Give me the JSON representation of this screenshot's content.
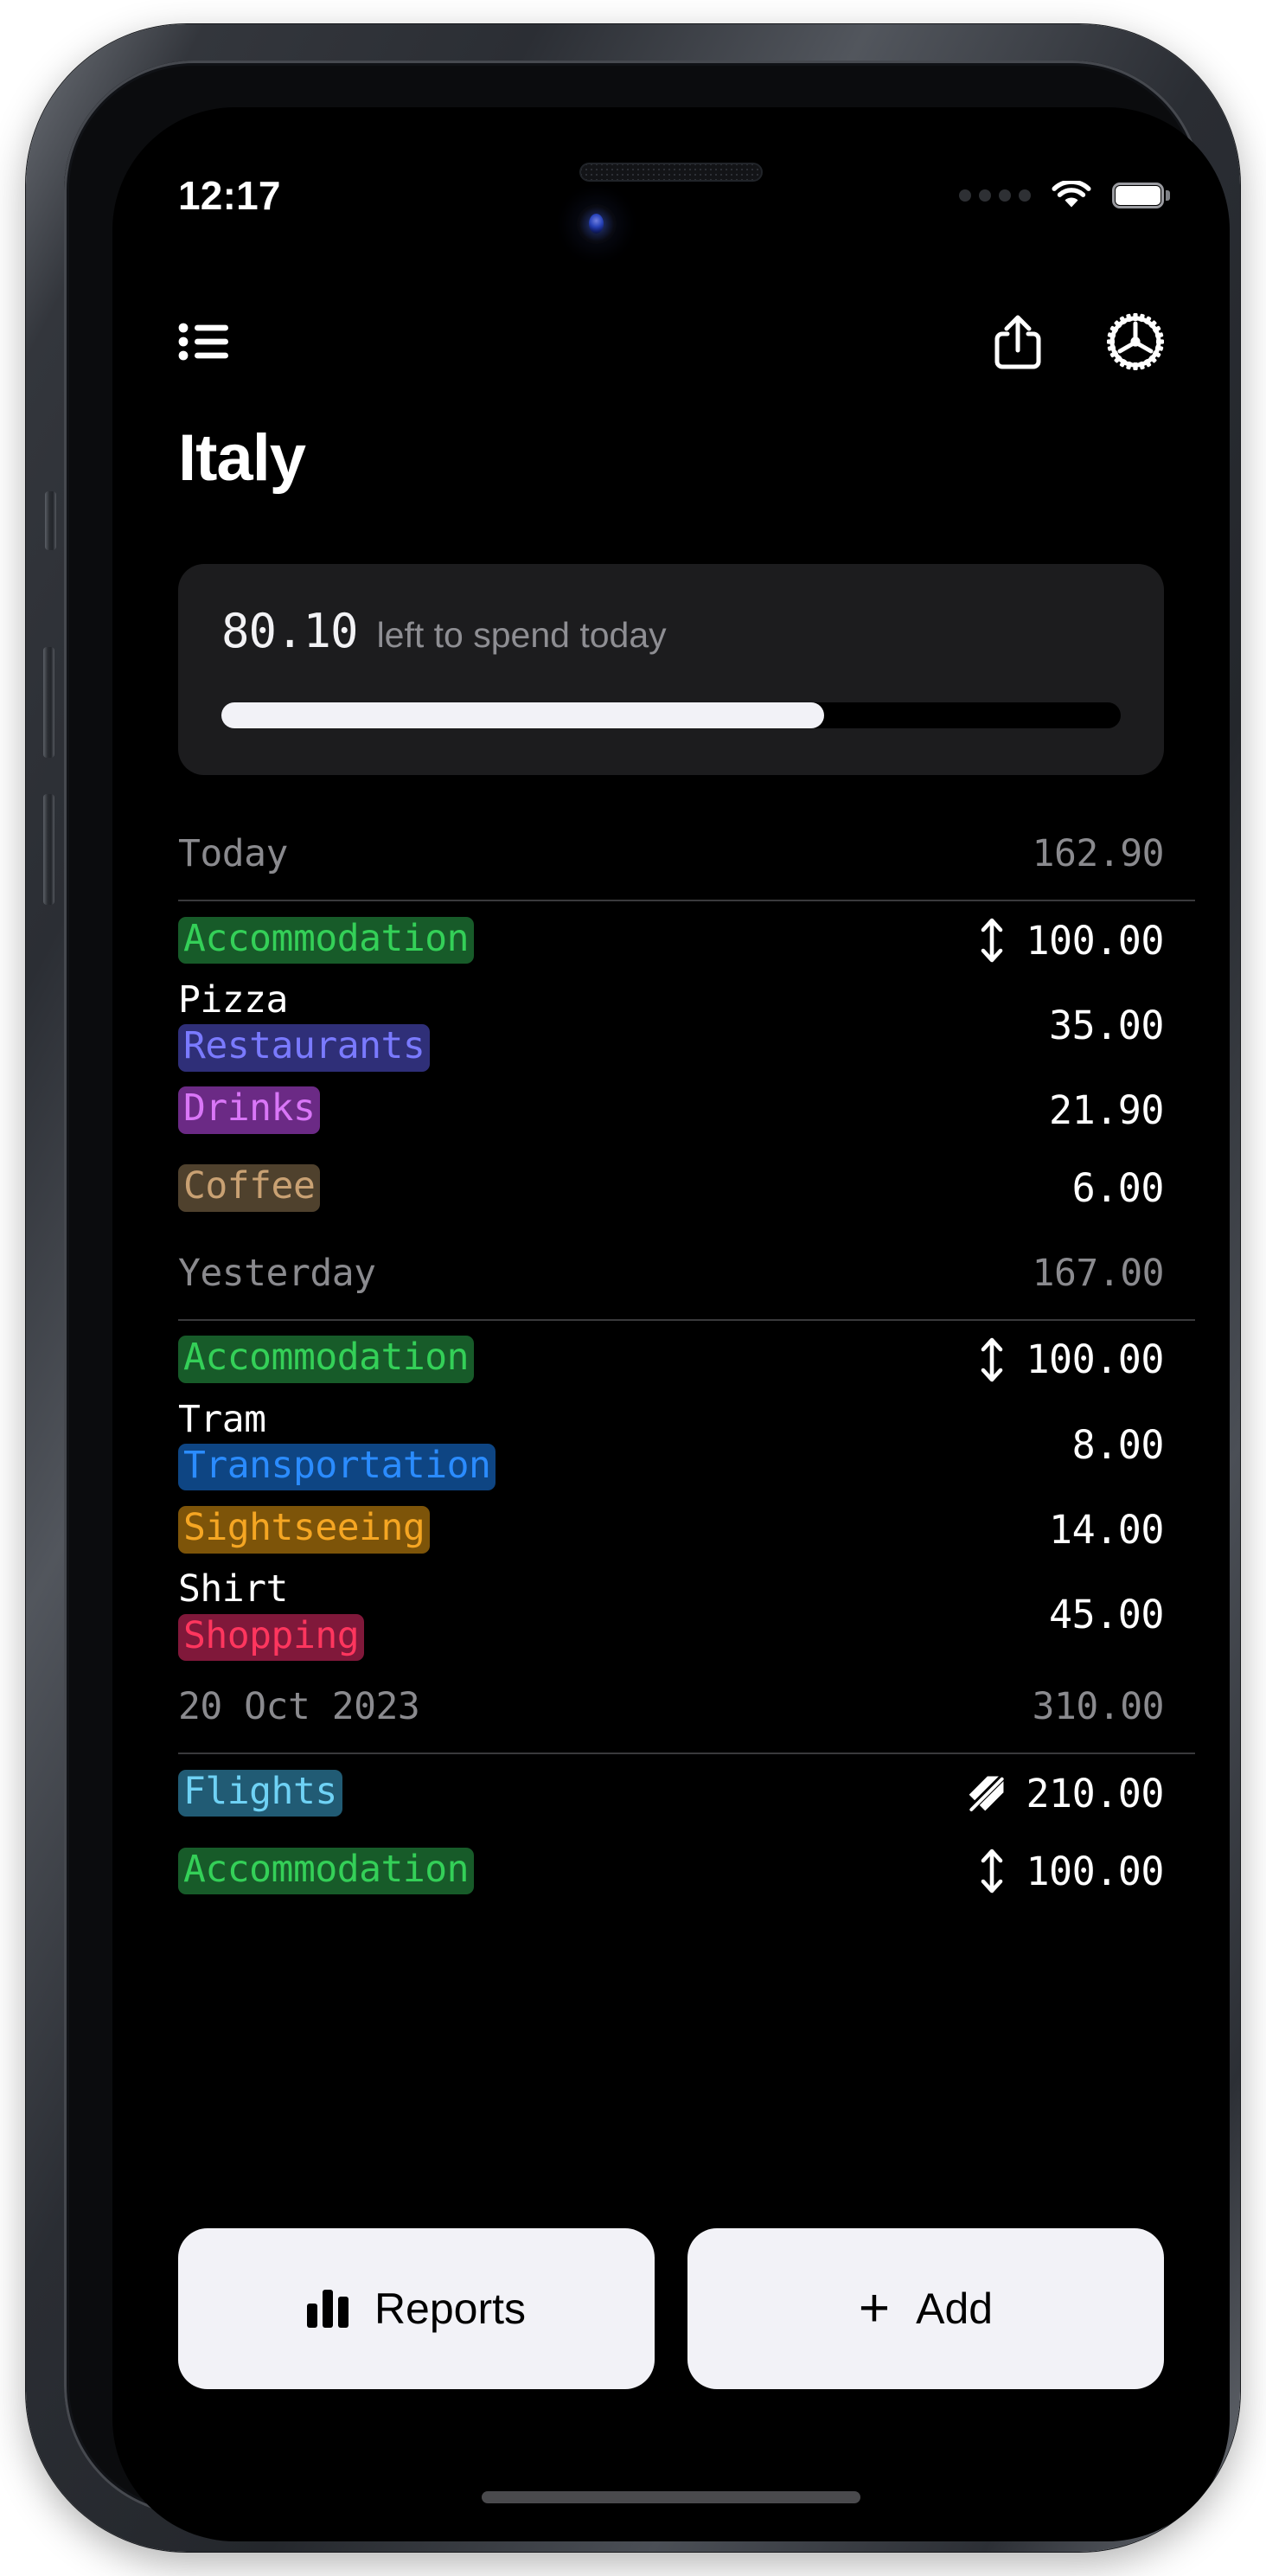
{
  "status_bar": {
    "time": "12:17",
    "signal_icon": "signal-dots-icon",
    "wifi_icon": "wifi-icon",
    "battery_icon": "battery-full-icon"
  },
  "header": {
    "menu_icon": "bulleted-list-icon",
    "share_icon": "share-icon",
    "settings_icon": "gear-icon"
  },
  "page_title": "Italy",
  "budget_card": {
    "amount": "80.10",
    "label": "left to spend today",
    "progress_percent": 67,
    "track_color": "#000000",
    "fill_color": "#f2f2f7",
    "card_color": "#1c1c1e"
  },
  "sections": [
    {
      "title": "Today",
      "total": "162.90",
      "rows": [
        {
          "note": "",
          "tag": "Accommodation",
          "tag_text_color": "#34d058",
          "tag_bg_color": "#175b29",
          "icon": "spread-arrows-icon",
          "amount": "100.00"
        },
        {
          "note": "Pizza",
          "tag": "Restaurants",
          "tag_text_color": "#7a7aff",
          "tag_bg_color": "#2f2f78",
          "icon": "",
          "amount": "35.00"
        },
        {
          "note": "",
          "tag": "Drinks",
          "tag_text_color": "#d976f7",
          "tag_bg_color": "#6b2a85",
          "icon": "",
          "amount": "21.90"
        },
        {
          "note": "",
          "tag": "Coffee",
          "tag_text_color": "#c9a173",
          "tag_bg_color": "#4f412d",
          "icon": "",
          "amount": "6.00"
        }
      ]
    },
    {
      "title": "Yesterday",
      "total": "167.00",
      "rows": [
        {
          "note": "",
          "tag": "Accommodation",
          "tag_text_color": "#34d058",
          "tag_bg_color": "#175b29",
          "icon": "spread-arrows-icon",
          "amount": "100.00"
        },
        {
          "note": "Tram",
          "tag": "Transportation",
          "tag_text_color": "#2b8cff",
          "tag_bg_color": "#0e4583",
          "icon": "",
          "amount": "8.00"
        },
        {
          "note": "",
          "tag": "Sightseeing",
          "tag_text_color": "#f5a623",
          "tag_bg_color": "#7d5409",
          "icon": "",
          "amount": "14.00"
        },
        {
          "note": "Shirt",
          "tag": "Shopping",
          "tag_text_color": "#ff365e",
          "tag_bg_color": "#80183a",
          "icon": "",
          "amount": "45.00"
        }
      ]
    },
    {
      "title": "20 Oct 2023",
      "total": "310.00",
      "rows": [
        {
          "note": "",
          "tag": "Flights",
          "tag_text_color": "#6fd2f5",
          "tag_bg_color": "#215b74",
          "icon": "tag-slash-icon",
          "amount": "210.00"
        },
        {
          "note": "",
          "tag": "Accommodation",
          "tag_text_color": "#34d058",
          "tag_bg_color": "#175b29",
          "icon": "spread-arrows-icon",
          "amount": "100.00"
        }
      ]
    }
  ],
  "bottom_bar": {
    "reports_label": "Reports",
    "reports_icon": "bar-chart-icon",
    "add_label": "Add",
    "add_icon": "plus-icon"
  }
}
